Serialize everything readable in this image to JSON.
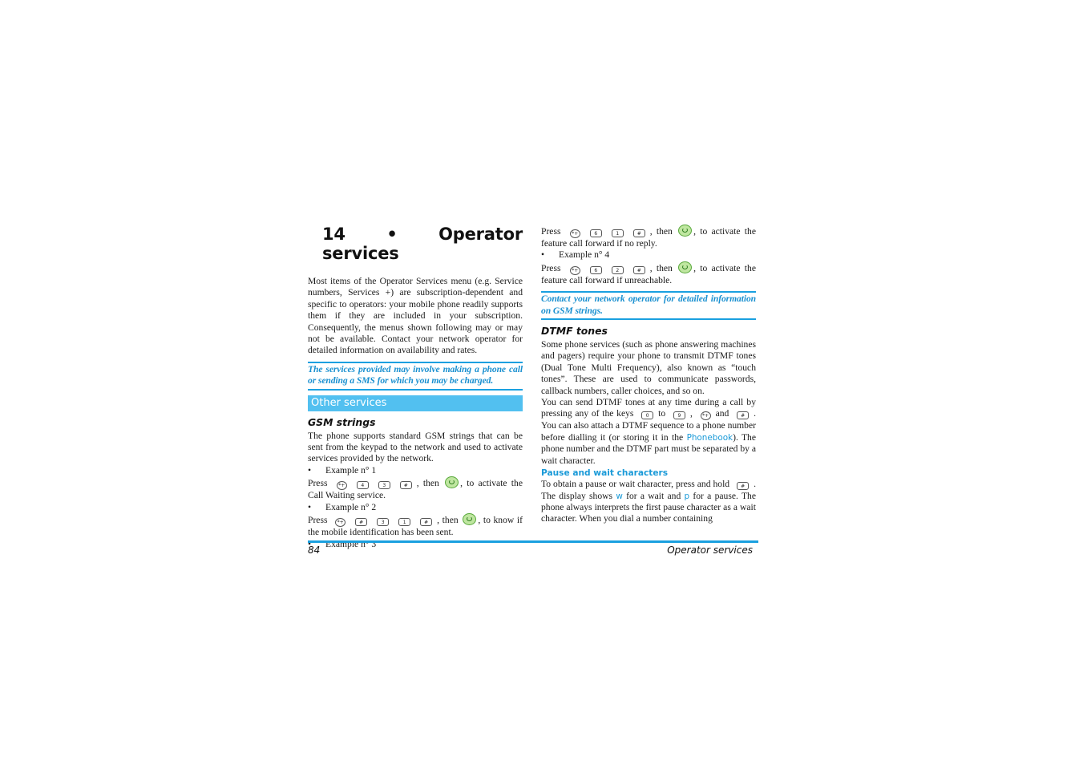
{
  "chapter": {
    "title": "14 • Operator services"
  },
  "left_column": {
    "intro": "Most items of the Operator Services menu (e.g. Service numbers, Services +) are subscription-dependent and specific to operators: your mobile phone readily supports them if they are included in your subscription. Consequently, the menus shown following may or may not be available. Contact your network operator for detailed information on availability and rates.",
    "note": "The services provided may involve making a phone call or sending a SMS for which you may be charged.",
    "section_title": "Other services",
    "gsm_heading": "GSM strings",
    "gsm_intro": "The phone supports standard GSM strings that can be sent from the keypad to the network and used to activate services provided by the network.",
    "examples": [
      {
        "label": "Example n° 1",
        "press": "Press",
        "keys": [
          "*+",
          "4",
          "3",
          "#"
        ],
        "then": ", then",
        "result": ", to activate the Call Waiting service."
      },
      {
        "label": "Example n° 2",
        "press": "Press",
        "keys": [
          "*+",
          "#",
          "3",
          "1",
          "#"
        ],
        "then": ", then",
        "result": ", to know if the mobile identification has been sent."
      },
      {
        "label": "Example n° 3"
      }
    ]
  },
  "right_column": {
    "example3_press": "Press",
    "example3_keys": [
      "*+",
      "6",
      "1",
      "#"
    ],
    "example3_then": ", then",
    "example3_result": ", to activate the feature call forward if no reply.",
    "example4_label": "Example n° 4",
    "example4_press": "Press",
    "example4_keys": [
      "*+",
      "6",
      "2",
      "#"
    ],
    "example4_then": ", then",
    "example4_result": ", to activate the feature call forward if unreachable.",
    "note": "Contact your network operator for detailed information on GSM strings.",
    "dtmf_heading": "DTMF tones",
    "dtmf_p1": "Some phone services (such as phone answering machines and pagers) require your phone to transmit DTMF tones (Dual Tone Multi Frequency), also known as “touch tones”. These are used to communicate passwords, callback numbers, caller choices, and so on.",
    "dtmf_p2_a": "You can send DTMF tones at any time during a call by pressing any of the keys",
    "dtmf_p2_key_from": "0",
    "dtmf_p2_to": "to",
    "dtmf_p2_key_to": "9",
    "dtmf_p2_comma": ",",
    "dtmf_p2_key_star": "*+",
    "dtmf_p2_and": "and",
    "dtmf_p2_key_hash": "#",
    "dtmf_p2_b": ". You can also attach a DTMF sequence to a phone number before dialling it (or storing it in the",
    "dtmf_p2_link": "Phonebook",
    "dtmf_p2_c": "). The phone number and the DTMF part must be separated by a wait character.",
    "pause_heading": "Pause and wait characters",
    "pause_a": "To obtain a pause or wait character, press and hold",
    "pause_key": "#",
    "pause_b": ". The display shows",
    "pause_w": "w",
    "pause_c": "for a wait and",
    "pause_p": "p",
    "pause_d": "for a pause. The phone always interprets the first pause character as a wait character. When you dial a number containing"
  },
  "footer": {
    "page_number": "84",
    "section": "Operator services"
  },
  "colors": {
    "accent": "#1aa0e0",
    "section_bar": "#52c0f0",
    "note_text": "#1a90d0"
  }
}
